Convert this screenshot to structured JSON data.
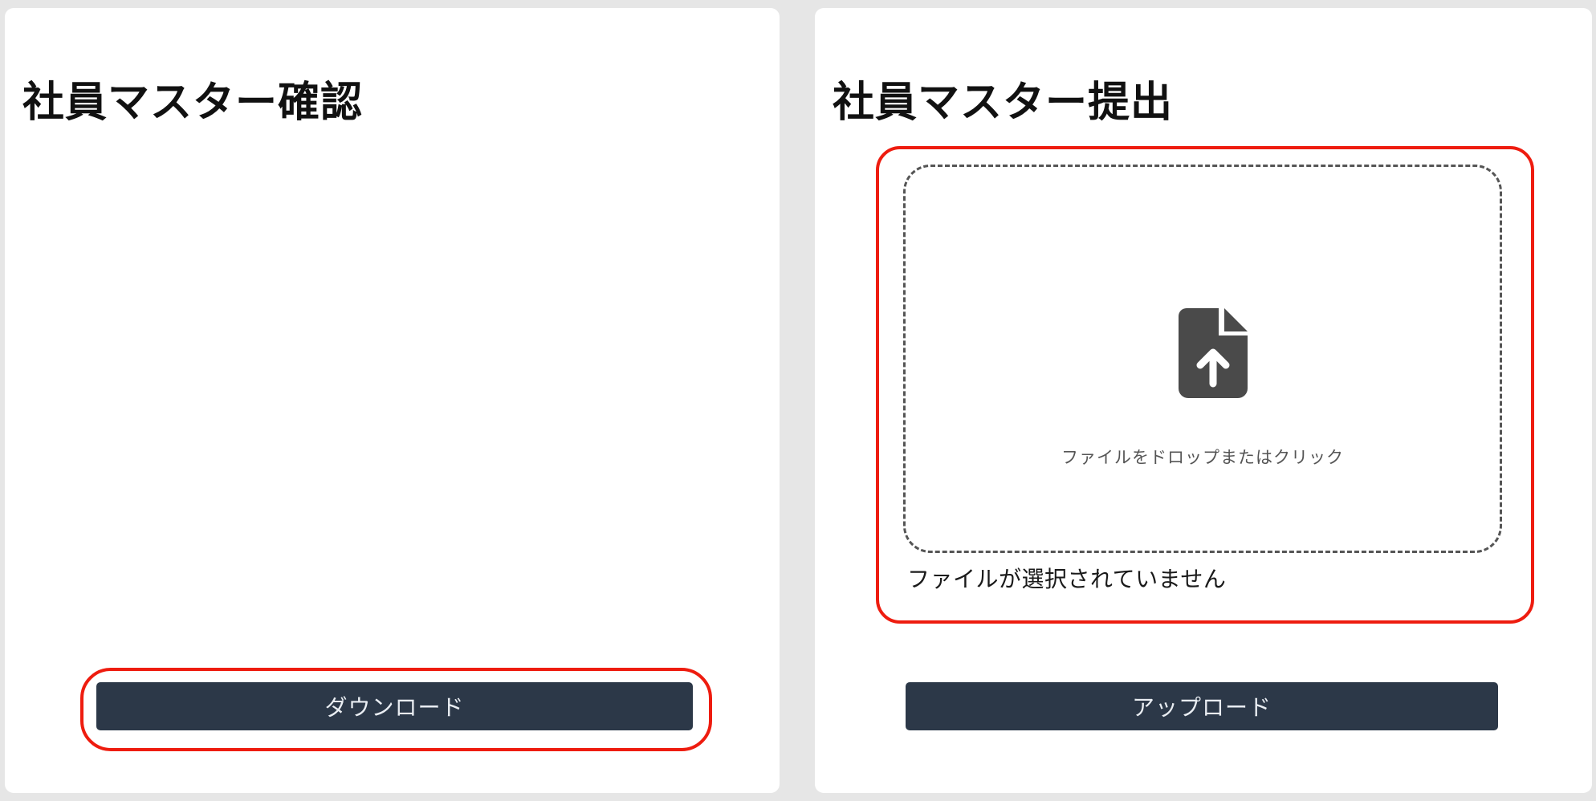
{
  "confirm_panel": {
    "title": "社員マスター確認",
    "download_label": "ダウンロード"
  },
  "submit_panel": {
    "title": "社員マスター提出",
    "dropzone": {
      "icon": "file-upload-icon",
      "text": "ファイルをドロップまたはクリック"
    },
    "file_status": "ファイルが選択されていません",
    "upload_label": "アップロード"
  },
  "colors": {
    "background": "#e6e6e6",
    "card": "#ffffff",
    "button": "#2c3848",
    "button_text": "#e9edf2",
    "highlight": "#ee1c0f",
    "icon": "#4a4a4a"
  }
}
